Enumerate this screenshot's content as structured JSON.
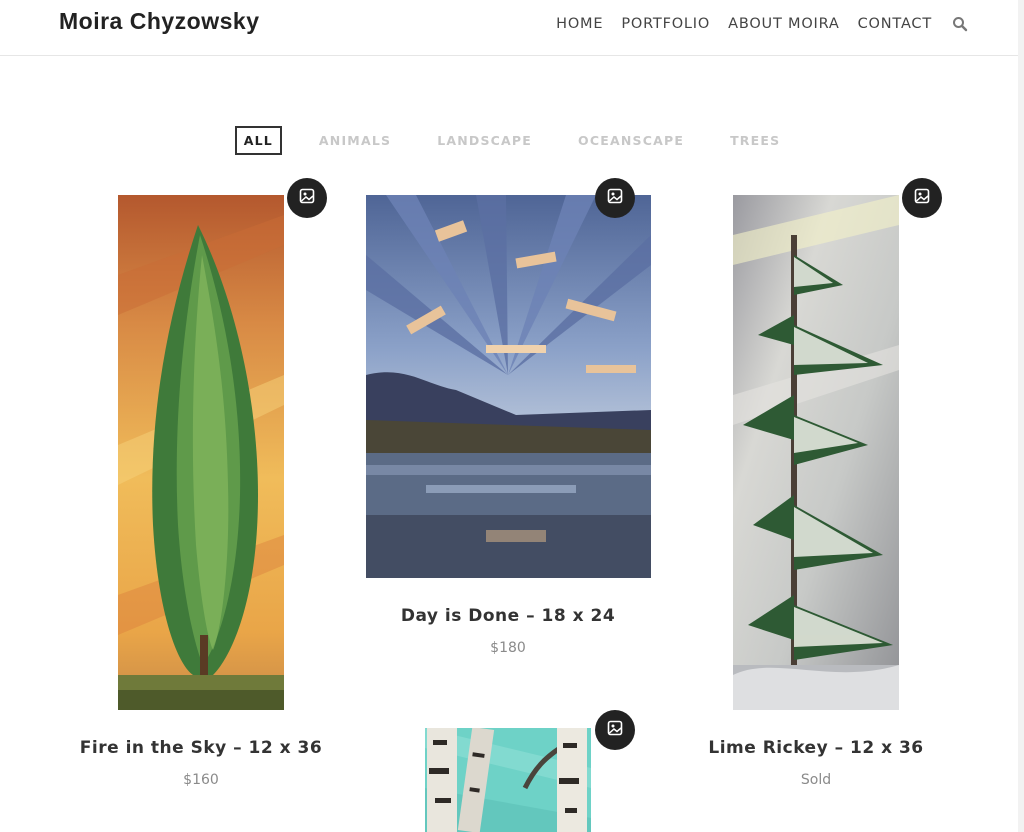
{
  "header": {
    "site_title": "Moira Chyzowsky",
    "nav": [
      "HOME",
      "PORTFOLIO",
      "ABOUT MOIRA",
      "CONTACT"
    ],
    "search_icon": "search-icon"
  },
  "filters": {
    "items": [
      "ALL",
      "ANIMALS",
      "LANDSCAPE",
      "OCEANSCAPE",
      "TREES"
    ],
    "active": "ALL"
  },
  "gallery": [
    {
      "title": "Fire in the Sky – 12 x 36",
      "price": "$160",
      "icon": "image-icon"
    },
    {
      "title": "Day is Done – 18 x 24",
      "price": "$180",
      "icon": "image-icon"
    },
    {
      "title": "Lime Rickey – 12 x 36",
      "price": "Sold",
      "icon": "image-icon"
    },
    {
      "title": "",
      "price": "",
      "icon": "image-icon"
    }
  ],
  "colors": {
    "text": "#333333",
    "muted": "#8a8a8a",
    "filter_inactive": "#c8c8c8",
    "button_bg": "#222222"
  }
}
